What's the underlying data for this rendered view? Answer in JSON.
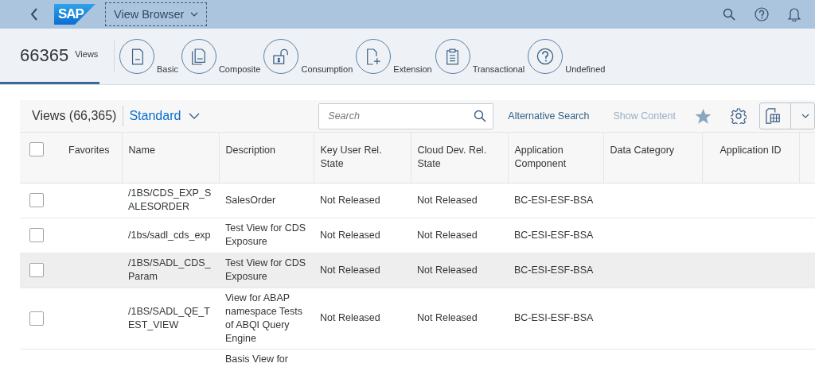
{
  "shell": {
    "logo": "SAP",
    "title": "View Browser"
  },
  "header": {
    "count": "66365",
    "count_label": "Views",
    "categories": [
      {
        "label": "Basic",
        "kind": "basic"
      },
      {
        "label": "Composite",
        "kind": "composite"
      },
      {
        "label": "Consumption",
        "kind": "consumption"
      },
      {
        "label": "Extension",
        "kind": "extension"
      },
      {
        "label": "Transactional",
        "kind": "transactional"
      },
      {
        "label": "Undefined",
        "kind": "undefined"
      }
    ]
  },
  "toolbar": {
    "title": "Views (66,365)",
    "variant": "Standard",
    "search": {
      "placeholder": "Search"
    },
    "alternative_search": "Alternative Search",
    "show_content": {
      "label": "Show Content",
      "disabled": true
    }
  },
  "table": {
    "select_all": false,
    "columns": [
      "Favorites",
      "Name",
      "Description",
      "Key User Rel. State",
      "Cloud Dev. Rel. State",
      "Application Component",
      "Data Category",
      "Application ID"
    ],
    "rows": [
      {
        "checked": false,
        "highlighted": false,
        "name": "/1BS/CDS_EXP_SALESORDER",
        "description": "SalesOrder",
        "key_user_state": "Not Released",
        "cloud_dev_state": "Not Released",
        "app_component": "BC-ESI-ESF-BSA"
      },
      {
        "checked": false,
        "highlighted": false,
        "name": "/1bs/sadl_cds_exp",
        "description": "Test View for CDS Exposure",
        "key_user_state": "Not Released",
        "cloud_dev_state": "Not Released",
        "app_component": "BC-ESI-ESF-BSA"
      },
      {
        "checked": false,
        "highlighted": true,
        "name": "/1BS/SADL_CDS_Param",
        "description": "Test View for CDS Exposure",
        "key_user_state": "Not Released",
        "cloud_dev_state": "Not Released",
        "app_component": "BC-ESI-ESF-BSA"
      },
      {
        "checked": false,
        "highlighted": false,
        "name": "/1BS/SADL_QE_TEST_VIEW",
        "description": "View for ABAP namespace Tests of ABQI Query Engine",
        "key_user_state": "Not Released",
        "cloud_dev_state": "Not Released",
        "app_component": "BC-ESI-ESF-BSA"
      },
      {
        "description": "Basis View for"
      }
    ]
  }
}
